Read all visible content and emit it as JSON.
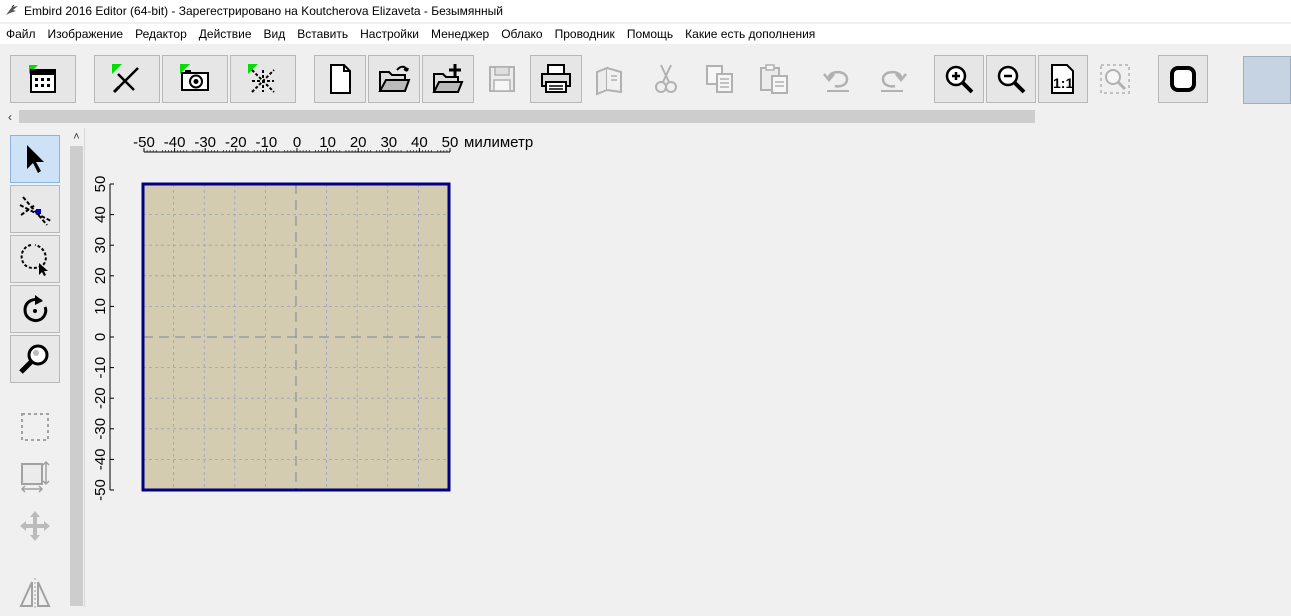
{
  "window": {
    "title": "Embird 2016 Editor (64-bit) - Зарегестрировано на Koutcherova Elizaveta - Безымянный"
  },
  "menu": [
    "Файл",
    "Изображение",
    "Редактор",
    "Действие",
    "Вид",
    "Вставить",
    "Настройки",
    "Менеджер",
    "Облако",
    "Проводник",
    "Помощь",
    "Какие есть дополнения"
  ],
  "toolbar": {
    "buttons": [
      {
        "name": "calendar-icon",
        "enabled": true
      },
      {
        "name": "draw-tool-icon",
        "enabled": true
      },
      {
        "name": "camera-icon",
        "enabled": true
      },
      {
        "name": "stitch-icon",
        "enabled": true
      },
      {
        "name": "new-file-icon",
        "enabled": true
      },
      {
        "name": "open-folder-icon",
        "enabled": true
      },
      {
        "name": "add-file-icon",
        "enabled": true
      },
      {
        "name": "save-icon",
        "enabled": false
      },
      {
        "name": "print-icon",
        "enabled": true
      },
      {
        "name": "export-icon",
        "enabled": false
      },
      {
        "name": "cut-icon",
        "enabled": false
      },
      {
        "name": "copy-icon",
        "enabled": false
      },
      {
        "name": "paste-icon",
        "enabled": false
      },
      {
        "name": "undo-icon",
        "enabled": false
      },
      {
        "name": "redo-icon",
        "enabled": false
      },
      {
        "name": "zoom-in-icon",
        "enabled": true
      },
      {
        "name": "zoom-out-icon",
        "enabled": true
      },
      {
        "name": "zoom-1-1-icon",
        "enabled": true,
        "label": "1:1"
      },
      {
        "name": "zoom-selection-icon",
        "enabled": false
      },
      {
        "name": "hoop-icon",
        "enabled": true
      }
    ]
  },
  "tools": [
    {
      "name": "select-arrow-icon",
      "state": "active"
    },
    {
      "name": "edit-nodes-icon",
      "state": "raised"
    },
    {
      "name": "lasso-icon",
      "state": "raised"
    },
    {
      "name": "rotate-icon",
      "state": "raised"
    },
    {
      "name": "zoom-tool-icon",
      "state": "raised"
    },
    {
      "name": "marquee-select-icon",
      "state": "disabled"
    },
    {
      "name": "resize-icon",
      "state": "disabled"
    },
    {
      "name": "move-icon",
      "state": "disabled"
    },
    {
      "name": "mirror-icon",
      "state": "disabled"
    }
  ],
  "ruler": {
    "x_ticks": [
      "-50",
      "-40",
      "-30",
      "-20",
      "-10",
      "0",
      "10",
      "20",
      "30",
      "40",
      "50"
    ],
    "y_ticks": [
      "50",
      "40",
      "30",
      "20",
      "10",
      "0",
      "-10",
      "-20",
      "-30",
      "-40",
      "-50"
    ],
    "unit": "милиметр"
  },
  "hoop": {
    "fill_color": "#d4ccb0",
    "border_color": "#000080",
    "grid_color": "#9aa0c0"
  }
}
